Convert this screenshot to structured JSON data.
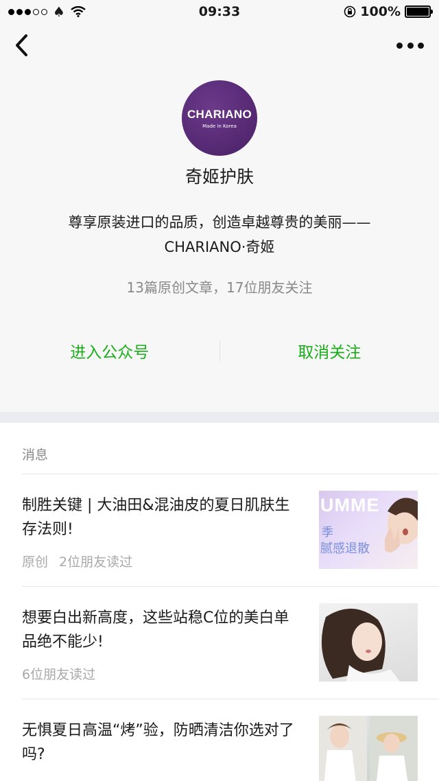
{
  "status_bar": {
    "time": "09:33",
    "battery": "100%",
    "battery_level": 1.0
  },
  "profile": {
    "avatar_brand": "CHARIANO",
    "avatar_sub": "Made in Korea",
    "name": "奇姬护肤",
    "intro_line1": "尊享原装进口的品质，创造卓越尊贵的美丽——",
    "intro_line2": "CHARIANO·奇姬",
    "stats": "13篇原创文章，17位朋友关注",
    "enter_label": "进入公众号",
    "unfollow_label": "取消关注"
  },
  "section_label": "消息",
  "articles": [
    {
      "title": "制胜关键 | 大油田&混油皮的夏日肌肤生存法则!",
      "original": "原创",
      "readers": "2位朋友读过",
      "thumb_text1": "UMME",
      "thumb_text2": "季",
      "thumb_text3": "腻感退散"
    },
    {
      "title": "想要白出新高度，这些站稳C位的美白单品绝不能少!",
      "readers": "6位朋友读过"
    },
    {
      "title": "无惧夏日高温“烤”验，防晒清洁你选对了吗?"
    }
  ],
  "colors": {
    "accent": "#1aad19",
    "brand_purple": "#4a1f66"
  }
}
